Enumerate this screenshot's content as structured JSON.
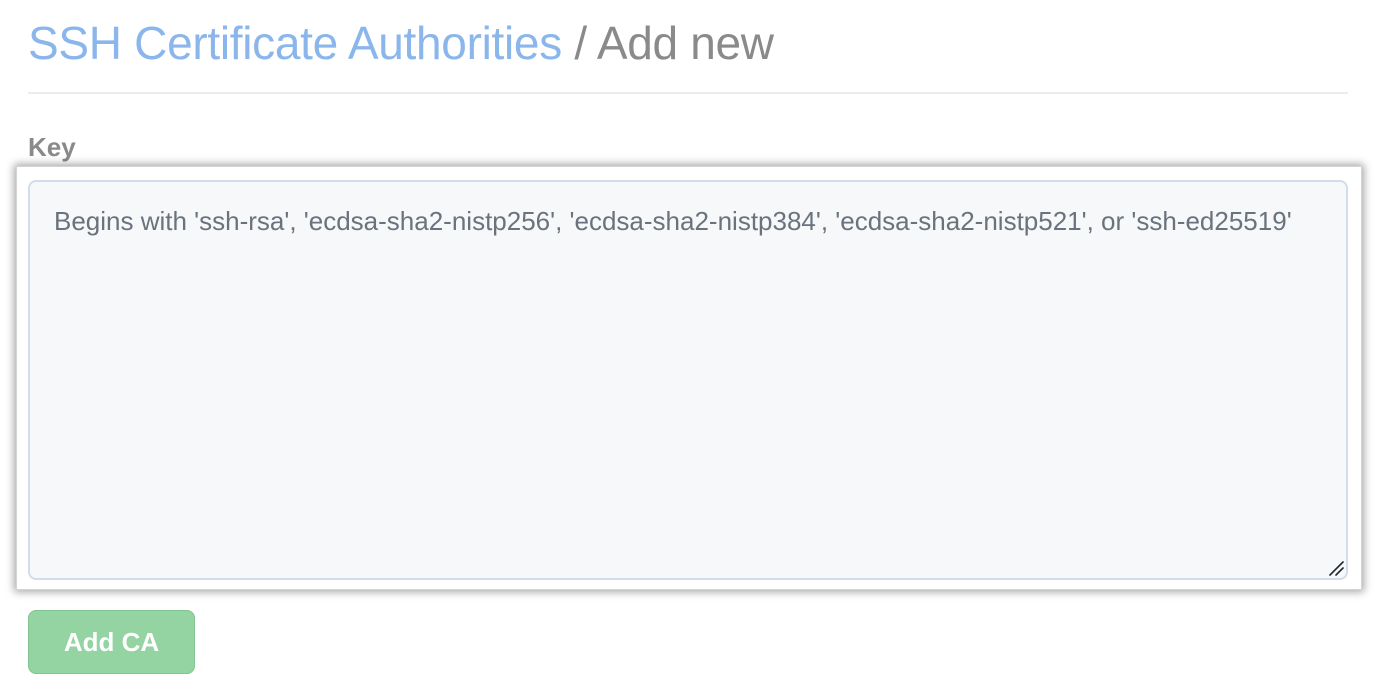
{
  "header": {
    "breadcrumb_link": "SSH Certificate Authorities",
    "separator": " / ",
    "current": "Add new"
  },
  "form": {
    "key_label": "Key",
    "key_value": "",
    "key_placeholder": "Begins with 'ssh-rsa', 'ecdsa-sha2-nistp256', 'ecdsa-sha2-nistp384', 'ecdsa-sha2-nistp521', or 'ssh-ed25519'",
    "submit_label": "Add CA",
    "submit_disabled": true
  },
  "icons": {
    "resize_grip": "resize-grip-icon"
  },
  "colors": {
    "link": "#8ab6eb",
    "muted_text": "#8a8a8a",
    "textarea_bg": "#f6f8fa",
    "button_bg": "#94d3a2"
  }
}
